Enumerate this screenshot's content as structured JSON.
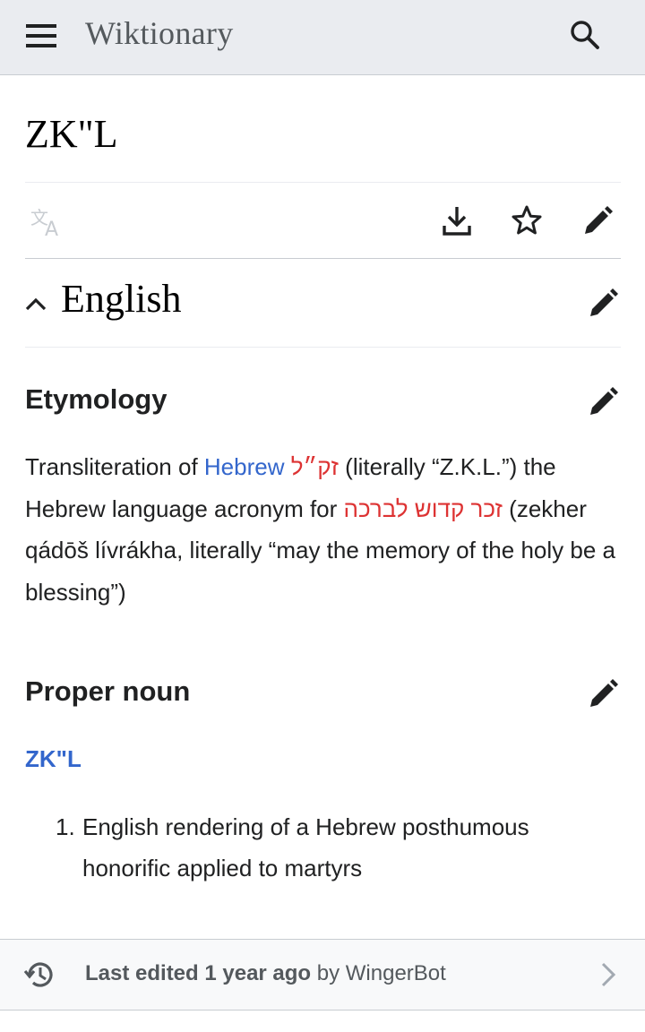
{
  "header": {
    "site_title": "Wiktionary",
    "menu_icon": "hamburger-menu-icon",
    "search_icon": "search-icon"
  },
  "page": {
    "title": "ZK\"L"
  },
  "toolbar": {
    "language_icon": "translate-icon",
    "download_icon": "download-icon",
    "watch_icon": "star-icon",
    "edit_icon": "pencil-icon"
  },
  "section": {
    "heading": "English",
    "collapse_icon": "chevron-up-icon"
  },
  "etymology": {
    "heading": "Etymology",
    "text_1": "Transliteration of ",
    "link_hebrew": "Hebrew",
    "text_2": " ",
    "hebrew_acronym": "זק״ל",
    "text_3": " (literally “Z.K.L.”) the Hebrew language acronym for ",
    "hebrew_phrase": "זכר קדוש לברכה",
    "text_4": " (zekher qádōš lívrákha, literally “may the memory of the holy be a blessing”)"
  },
  "proper_noun": {
    "heading": "Proper noun",
    "headword": "ZK\"L",
    "definitions": [
      {
        "num": "1.",
        "text": "English rendering of a Hebrew posthumous honorific applied to martyrs"
      }
    ]
  },
  "footer": {
    "prefix": "Last edited ",
    "time": "1 year ago",
    "by": " by ",
    "editor": "WingerBot"
  },
  "colors": {
    "link": "#3366cc",
    "redlink": "#dd3333",
    "header_bg": "#eaecf0"
  }
}
